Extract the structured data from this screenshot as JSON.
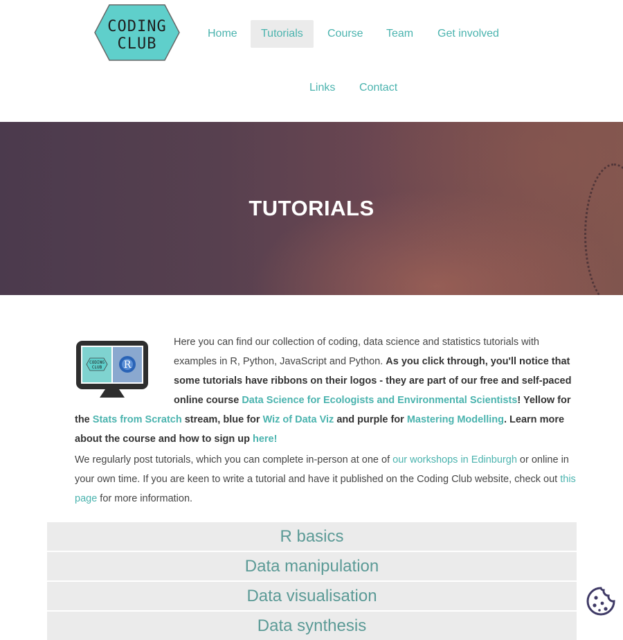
{
  "header": {
    "logo_line1": "CODING",
    "logo_line2": "CLUB",
    "nav": [
      {
        "label": "Home"
      },
      {
        "label": "Tutorials",
        "active": true
      },
      {
        "label": "Course"
      },
      {
        "label": "Team"
      },
      {
        "label": "Get involved"
      },
      {
        "label": "Links"
      },
      {
        "label": "Contact"
      }
    ]
  },
  "hero": {
    "title": "TUTORIALS"
  },
  "intro": {
    "p1_text1": "Here you can find our collection of coding, data science and statistics tutorials with examples in R, Python, JavaScript and Python. ",
    "p1_bold1": "As you click through, you'll notice that some tutorials have ribbons on their logos - they are part of our free and self-paced online course ",
    "p1_link_course": "Data Science for Ecologists and Environmental Scientists",
    "p1_bold2": "! Yellow for the ",
    "p1_link_stats": "Stats from Scratch",
    "p1_bold3": " stream, blue for ",
    "p1_link_wiz": "Wiz of Data Viz",
    "p1_bold4": " and purple for ",
    "p1_link_model": "Mastering Modelling",
    "p1_bold5": ". Learn more about the course and how to sign up ",
    "p1_link_here": "here!",
    "p2_text1": "We regularly post tutorials, which you can complete in-person at one of ",
    "p2_link_workshops": "our workshops in Edinburgh",
    "p2_text2": " or online in your own time. If you are keen to write a tutorial and have it published on the Coding Club website, check out ",
    "p2_link_page": "this page",
    "p2_text3": " for more information."
  },
  "categories": [
    {
      "label": "R basics"
    },
    {
      "label": "Data manipulation"
    },
    {
      "label": "Data visualisation"
    },
    {
      "label": "Data synthesis"
    }
  ],
  "colors": {
    "accent": "#4ab3ae",
    "category_text": "#5b9a96",
    "category_bg": "#ebebeb",
    "cookie": "#3f3a66"
  },
  "icons": {
    "monitor": "monitor-icon",
    "cookie": "cookie-icon"
  }
}
